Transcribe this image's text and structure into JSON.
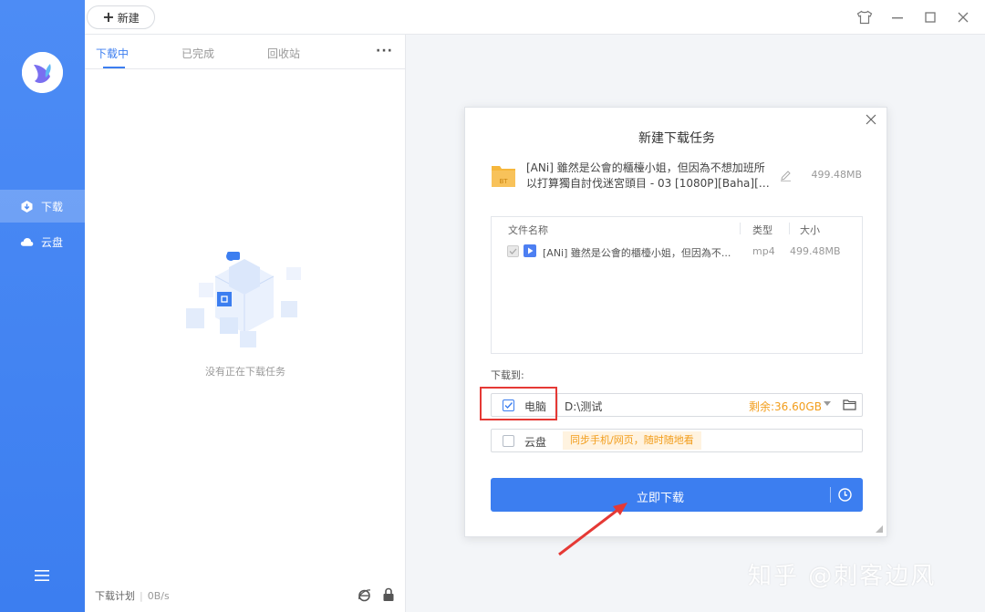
{
  "sidebar": {
    "items": [
      {
        "label": "下载",
        "icon": "download-icon"
      },
      {
        "label": "云盘",
        "icon": "cloud-icon"
      }
    ]
  },
  "toolbar": {
    "new_label": "新建"
  },
  "tabs": [
    {
      "label": "下载中"
    },
    {
      "label": "已完成"
    },
    {
      "label": "回收站"
    }
  ],
  "empty_state": {
    "text": "没有正在下载任务"
  },
  "footer": {
    "plan_label": "下载计划",
    "speed": "0B/s"
  },
  "dialog": {
    "title": "新建下载任务",
    "torrent": {
      "name_line1": "[ANi] 雖然是公會的櫃檯小姐，但因為不想加班所",
      "name_line2": "以打算獨自討伐迷宮頭目 - 03 [1080P][Baha][W...",
      "size": "499.48MB"
    },
    "table": {
      "headers": {
        "name": "文件名称",
        "type": "类型",
        "size": "大小"
      },
      "rows": [
        {
          "name": "[ANi] 雖然是公會的櫃檯小姐，但因為不...",
          "type": "mp4",
          "size": "499.48MB"
        }
      ]
    },
    "save_to_label": "下载到:",
    "pc": {
      "label": "电脑",
      "path": "D:\\测试",
      "free": "剩余:36.60GB",
      "checked": true
    },
    "cloud": {
      "label": "云盘",
      "promo": "同步手机/网页，随时随地看",
      "checked": false
    },
    "download_button": "立即下载"
  },
  "watermark": "知乎 @刺客边风",
  "colors": {
    "accent": "#3c7ef0",
    "warning": "#f29d1b",
    "highlight": "#e53935"
  }
}
